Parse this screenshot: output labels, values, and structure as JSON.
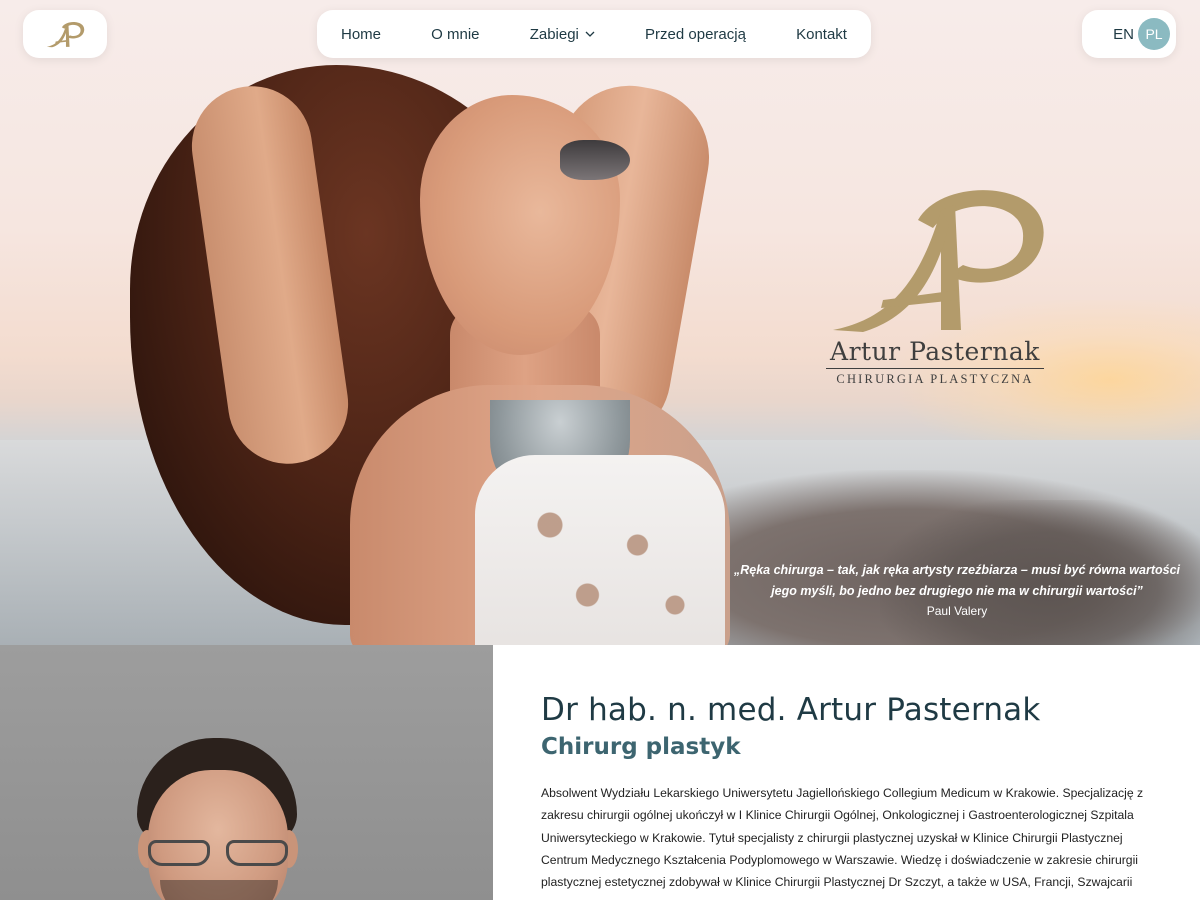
{
  "nav": {
    "logo_alt": "AP",
    "items": [
      {
        "label": "Home"
      },
      {
        "label": "O mnie"
      },
      {
        "label": "Zabiegi",
        "has_dropdown": true
      },
      {
        "label": "Przed operacją"
      },
      {
        "label": "Kontakt"
      }
    ]
  },
  "lang": {
    "options": [
      "EN",
      "PL"
    ],
    "active": "PL"
  },
  "hero": {
    "brand_name": "Artur Pasternak",
    "brand_sub": "CHIRURGIA PLASTYCZNA",
    "quote_line1": "„Ręka chirurga – tak, jak ręka artysty rzeźbiarza – musi być równa wartości",
    "quote_line2": "jego myśli, bo jedno bez drugiego nie ma w chirurgii wartości”",
    "quote_author": "Paul Valery"
  },
  "about": {
    "title": "Dr hab. n. med. Artur Pasternak",
    "subtitle": "Chirurg plastyk",
    "text": "Absolwent Wydziału Lekarskiego Uniwersytetu Jagiellońskiego Collegium Medicum w Krakowie. Specjalizację z zakresu chirurgii ogólnej ukończył w I Klinice Chirurgii Ogólnej, Onkologicznej i Gastroenterologicznej Szpitala Uniwersyteckiego w Krakowie. Tytuł specjalisty z chirurgii plastycznej uzyskał w Klinice Chirurgii Plastycznej Centrum Medycznego Kształcenia Podyplomowego w Warszawie. Wiedzę i doświadczenie w zakresie chirurgii plastycznej estetycznej zdobywał w Klinice Chirurgii Plastycznej Dr Szczyt, a także w USA, Francji, Szwajcarii"
  },
  "colors": {
    "accent_gold": "#b39b6b",
    "lang_active_bg": "#8bbac1",
    "heading": "#1f3a44",
    "subheading": "#3d6570"
  },
  "icons": [
    "ap-logo-icon",
    "chevron-down-icon",
    "ap-monogram-icon"
  ]
}
